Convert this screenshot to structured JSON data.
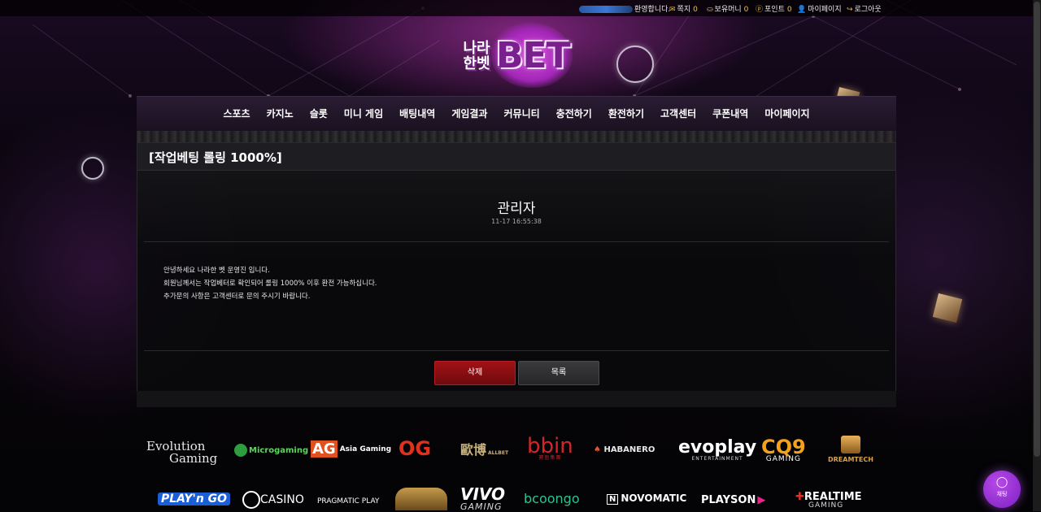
{
  "topbar": {
    "welcome_suffix": "환영합니다.",
    "links": [
      {
        "label": "쪽지",
        "count": "0",
        "icon": "mail-icon",
        "glyph": "✉"
      },
      {
        "label": "보유머니",
        "count": "0",
        "icon": "money-icon",
        "glyph": "⛀"
      },
      {
        "label": "포인트",
        "count": "0",
        "icon": "point-icon",
        "glyph": "ⓟ"
      },
      {
        "label": "마이페이지",
        "count": null,
        "icon": "user-icon",
        "glyph": "👤"
      },
      {
        "label": "로그아웃",
        "count": null,
        "icon": "logout-icon",
        "glyph": "↪"
      }
    ]
  },
  "logo": {
    "korean": "나라\n한벳",
    "english": "BET"
  },
  "nav": {
    "items": [
      "스포츠",
      "카지노",
      "슬롯",
      "미니 게임",
      "배팅내역",
      "게임결과",
      "커뮤니티",
      "충전하기",
      "환전하기",
      "고객센터",
      "쿠폰내역",
      "마이페이지"
    ]
  },
  "post": {
    "title": "[작업베팅 롤링 1000%]",
    "author": "관리자",
    "datetime": "11-17 16:55:38",
    "lines": [
      "안녕하세요 나라한 벳 운영진 입니다.",
      "회원님께서는 작업베터로 확인되어 롤링 1000% 이후 환전 가능하십니다.",
      "추가문의 사항은 고객센터로 문의 주시기 바랍니다."
    ],
    "delete_label": "삭제",
    "list_label": "목록"
  },
  "providers": [
    {
      "name": "Evolution",
      "sub": "Gaming"
    },
    {
      "name": "Microgaming",
      "sub": ""
    },
    {
      "name": "AG",
      "sub": "Asia Gaming"
    },
    {
      "name": "OG",
      "sub": ""
    },
    {
      "name": "歐博",
      "sub": "ALLBET"
    },
    {
      "name": "bbin",
      "sub": "寶盈集團"
    },
    {
      "name": "HABANERO",
      "sub": ""
    },
    {
      "name": "evoplay",
      "sub": "ENTERTAINMENT"
    },
    {
      "name": "CQ9",
      "sub": "GAMING"
    },
    {
      "name": "DREAMTECH",
      "sub": ""
    },
    {
      "name": "PLAY'n GO",
      "sub": ""
    },
    {
      "name": "CASINO",
      "sub": ""
    },
    {
      "name": "PRAGMATIC PLAY",
      "sub": ""
    },
    {
      "name": "",
      "sub": ""
    },
    {
      "name": "VIVO",
      "sub": "GAMING"
    },
    {
      "name": "bcoongo",
      "sub": ""
    },
    {
      "name": "NOVOMATIC",
      "sub": ""
    },
    {
      "name": "PLAYSON",
      "sub": ""
    },
    {
      "name": "REALTIME",
      "sub": "GAMING"
    }
  ],
  "chat": {
    "label": "채팅"
  },
  "colors": {
    "accent": "#7c1fc2",
    "delete": "#a01216",
    "gold": "#f2c14e"
  }
}
